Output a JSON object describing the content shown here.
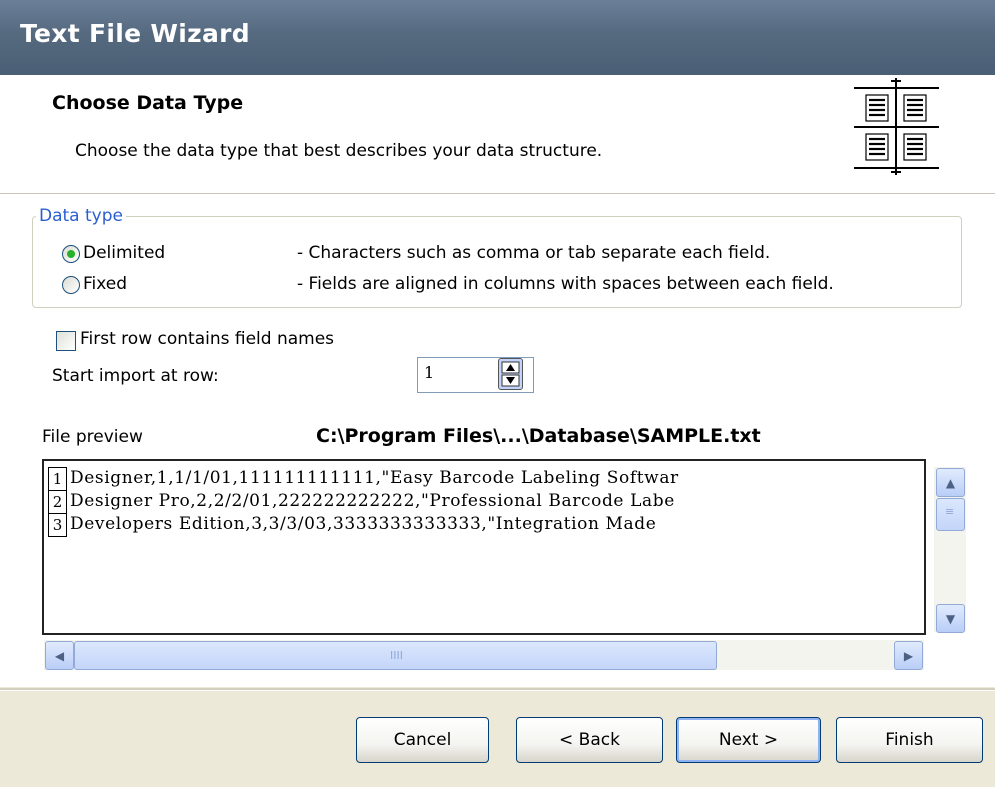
{
  "window": {
    "title": "Text File Wizard"
  },
  "header": {
    "title": "Choose Data Type",
    "description": "Choose the data type that best describes your data structure.",
    "icon": "columns-icon"
  },
  "data_type": {
    "legend": "Data type",
    "options": [
      {
        "label": "Delimited",
        "description": "- Characters such as comma or tab separate each field.",
        "selected": true
      },
      {
        "label": "Fixed",
        "description": "- Fields are aligned in columns with spaces between each field.",
        "selected": false
      }
    ]
  },
  "options": {
    "first_row_label": "First row contains field names",
    "first_row_checked": false,
    "start_row_label": "Start import at row:",
    "start_row_value": "1"
  },
  "preview": {
    "label": "File preview",
    "path": "C:\\Program Files\\...\\Database\\SAMPLE.txt",
    "rows": [
      {
        "num": "1",
        "text": "Designer,1,1/1/01,111111111111,\"Easy Barcode Labeling Softwar"
      },
      {
        "num": "2",
        "text": "Designer Pro,2,2/2/01,222222222222,\"Professional Barcode Labe"
      },
      {
        "num": "3",
        "text": "Developers Edition,3,3/3/03,3333333333333,\"Integration Made"
      }
    ],
    "h_scroll_position": 0
  },
  "buttons": {
    "cancel": "Cancel",
    "back": "< Back",
    "next": "Next >",
    "finish": "Finish"
  },
  "colors": {
    "title_bar": "#55697f",
    "group_legend": "#2a5fd0",
    "radio_selected": "#25b22a",
    "button_border": "#003c74"
  }
}
